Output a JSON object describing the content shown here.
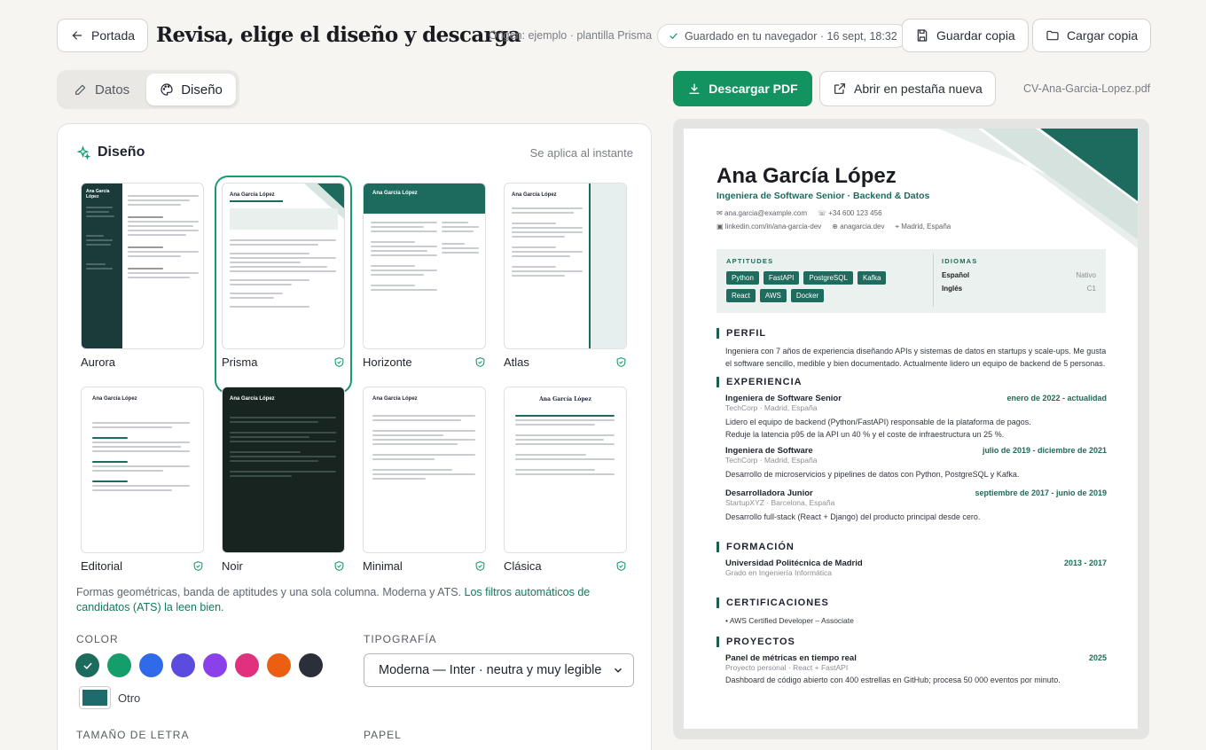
{
  "header": {
    "back_label": "Portada",
    "title": "Revisa, elige el diseño y descarga",
    "origin": "Origen: ejemplo · plantilla Prisma",
    "saved": "Guardado en tu navegador · 16 sept, 18:32",
    "save_copy": "Guardar copia",
    "load_copy": "Cargar copia"
  },
  "tabs": {
    "datos": "Datos",
    "diseno": "Diseño"
  },
  "actions": {
    "download": "Descargar PDF",
    "open_tab": "Abrir en pestaña nueva",
    "filename": "CV-Ana-Garcia-Lopez.pdf"
  },
  "design_panel": {
    "title": "Diseño",
    "hint": "Se aplica al instante",
    "templates": [
      {
        "name": "Aurora"
      },
      {
        "name": "Prisma"
      },
      {
        "name": "Horizonte"
      },
      {
        "name": "Atlas"
      },
      {
        "name": "Editorial"
      },
      {
        "name": "Noir"
      },
      {
        "name": "Minimal"
      },
      {
        "name": "Clásica"
      }
    ],
    "description": "Formas geométricas, banda de aptitudes y una sola columna. Moderna y ATS.",
    "ats_note": "Los filtros automáticos de candidatos (ATS) la leen bien.",
    "color_label": "COLOR",
    "colors": [
      "#1d6b5d",
      "#149e6b",
      "#2f6be9",
      "#5b4bdf",
      "#8b41ea",
      "#e0307e",
      "#ea5f12",
      "#2b2f3a"
    ],
    "other_color": "#1d6b6b",
    "other_label": "Otro",
    "typography_label": "TIPOGRAFÍA",
    "typography_value": "Moderna — Inter · neutra y muy legible",
    "font_size_label": "TAMAÑO DE LETRA",
    "paper_label": "PAPEL"
  },
  "resume": {
    "name": "Ana García López",
    "role": "Ingeniera de Software Senior · Backend & Datos",
    "email": "ana.garcia@example.com",
    "phone": "+34 600 123 456",
    "linkedin": "linkedin.com/in/ana-garcia-dev",
    "web": "anagarcia.dev",
    "location": "Madrid, España",
    "skills_label": "APTITUDES",
    "skills": [
      "Python",
      "FastAPI",
      "PostgreSQL",
      "Kafka",
      "React",
      "AWS",
      "Docker"
    ],
    "languages_label": "IDIOMAS",
    "languages": [
      {
        "name": "Español",
        "level": "Nativo"
      },
      {
        "name": "Inglés",
        "level": "C1"
      }
    ],
    "profile_label": "PERFIL",
    "profile": "Ingeniera con 7 años de experiencia diseñando APIs y sistemas de datos en startups y scale-ups. Me gusta el software sencillo, medible y bien documentado. Actualmente lidero un equipo de backend de 5 personas.",
    "experience_label": "EXPERIENCIA",
    "jobs": [
      {
        "title": "Ingeniera de Software Senior",
        "dates": "enero de 2022 - actualidad",
        "sub": "TechCorp · Madrid, España",
        "lines": [
          "Lidero el equipo de backend (Python/FastAPI) responsable de la plataforma de pagos.",
          "Reduje la latencia p95 de la API un 40 % y el coste de infraestructura un 25 %."
        ]
      },
      {
        "title": "Ingeniera de Software",
        "dates": "julio de 2019 - diciembre de 2021",
        "sub": "TechCorp · Madrid, España",
        "lines": [
          "Desarrollo de microservicios y pipelines de datos con Python, PostgreSQL y Kafka."
        ]
      },
      {
        "title": "Desarrolladora Junior",
        "dates": "septiembre de 2017 - junio de 2019",
        "sub": "StartupXYZ · Barcelona, España",
        "lines": [
          "Desarrollo full-stack (React + Django) del producto principal desde cero."
        ]
      }
    ],
    "education_label": "FORMACIÓN",
    "edu_title": "Universidad Politécnica de Madrid",
    "edu_dates": "2013 - 2017",
    "edu_sub": "Grado en Ingeniería Informática",
    "cert_label": "CERTIFICACIONES",
    "cert": "AWS Certified Developer – Associate",
    "projects_label": "PROYECTOS",
    "proj_title": "Panel de métricas en tiempo real",
    "proj_date": "2025",
    "proj_sub": "Proyecto personal · React + FastAPI",
    "proj_desc": "Dashboard de código abierto con 400 estrellas en GitHub; procesa 50 000 eventos por minuto."
  }
}
